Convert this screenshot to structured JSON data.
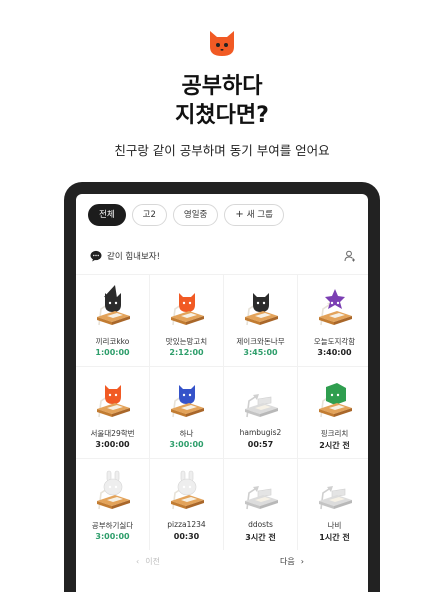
{
  "brand": {
    "logo_icon": "orange-cat-logo-icon",
    "color": "#f15a24"
  },
  "hero": {
    "title_line1": "공부하다",
    "title_line2": "지쳤다면?",
    "subtitle": "친구랑 같이 공부하며 동기 부여를 얻어요"
  },
  "tabs": [
    {
      "label": "전체",
      "active": true
    },
    {
      "label": "고2",
      "active": false
    },
    {
      "label": "영일중",
      "active": false
    },
    {
      "label": "새 그룹",
      "active": false,
      "icon": "plus-icon"
    }
  ],
  "group_message": {
    "icon": "chat-bubble-icon",
    "text": "같이 힘내보자!",
    "action_icon": "add-user-icon"
  },
  "members": [
    {
      "name": "끼리코kko",
      "time": "1:00:00",
      "studying": true,
      "character": "black-witch",
      "color": "#2b2b2b"
    },
    {
      "name": "맛있는망고치",
      "time": "2:12:00",
      "studying": true,
      "character": "orange-cat",
      "color": "#f15a24"
    },
    {
      "name": "제이크와돈나무",
      "time": "3:45:00",
      "studying": true,
      "character": "black-cat",
      "color": "#2b2b2b"
    },
    {
      "name": "오늘도지각함",
      "time": "3:40:00",
      "studying": false,
      "character": "purple-star",
      "color": "#7b3fb3"
    },
    {
      "name": "서울대29학번",
      "time": "3:00:00",
      "studying": false,
      "character": "orange-cat",
      "color": "#f15a24"
    },
    {
      "name": "하나",
      "time": "3:00:00",
      "studying": true,
      "character": "blue-bird",
      "color": "#3553c9"
    },
    {
      "name": "hambugis2",
      "time": "00:57",
      "studying": false,
      "character": "empty",
      "color": "#d5d5d5"
    },
    {
      "name": "핑크리치",
      "time": "2시간 전",
      "studying": false,
      "character": "green-block",
      "color": "#2f9e4f"
    },
    {
      "name": "공부하기싫다",
      "time": "3:00:00",
      "studying": true,
      "character": "white-rabbit",
      "color": "#eeeeee"
    },
    {
      "name": "pizza1234",
      "time": "00:30",
      "studying": false,
      "character": "white-rabbit",
      "color": "#eeeeee"
    },
    {
      "name": "ddosts",
      "time": "3시간 전",
      "studying": false,
      "character": "empty",
      "color": "#d5d5d5"
    },
    {
      "name": "나비",
      "time": "1시간 전",
      "studying": false,
      "character": "empty",
      "color": "#d5d5d5"
    }
  ],
  "pager": {
    "prev_label": "이전",
    "next_label": "다음",
    "prev_icon": "chevron-left-icon",
    "next_icon": "chevron-right-icon"
  },
  "colors": {
    "active_time": "#2e9e6b",
    "device_frame": "#222222",
    "chip_active_bg": "#1c1c1c"
  }
}
